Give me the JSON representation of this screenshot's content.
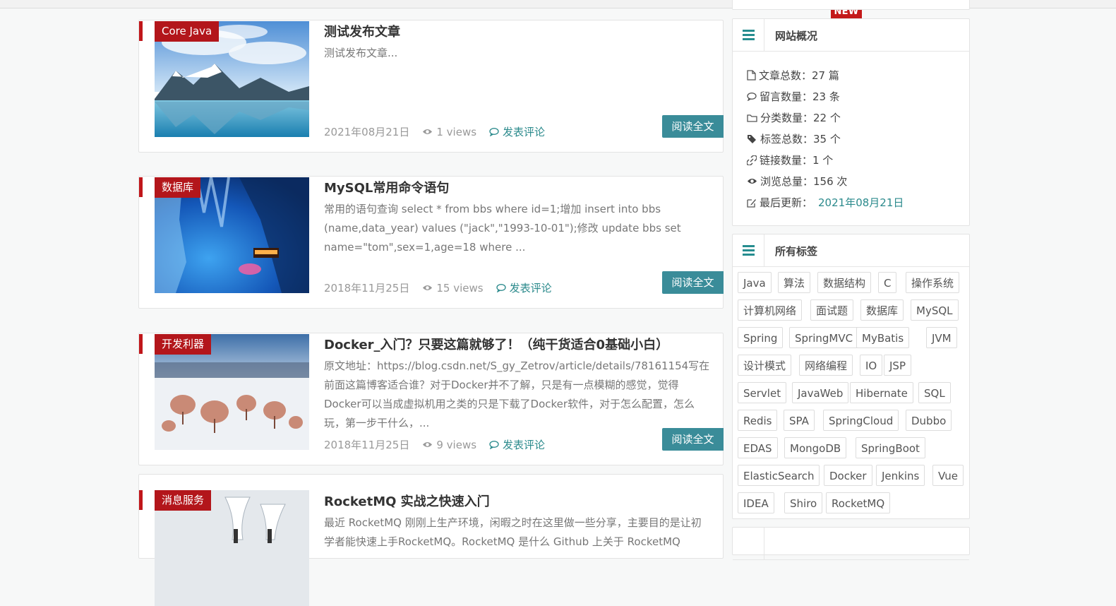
{
  "colors": {
    "accent": "#3a8c99",
    "category": "#b3161b",
    "link": "#2b8a8c",
    "badge": "#c4191a"
  },
  "badge_new": "NEW",
  "posts": [
    {
      "category": "Core Java",
      "title": "测试发布文章",
      "excerpt": "测试发布文章...",
      "date": "2021年08月21日",
      "views": "1 views",
      "comment": "发表评论",
      "read_more": "阅读全文",
      "image": "snow-mountain-lake"
    },
    {
      "category": "数据库",
      "title": "MySQL常用命令语句",
      "excerpt": "常用的语句查询 select * from bbs where id=1;增加 insert into bbs (name,data_year) values (\"jack\",\"1993-10-01\");修改 update bbs set name=\"tom\",sex=1,age=18 where ...",
      "date": "2018年11月25日",
      "views": "15 views",
      "comment": "发表评论",
      "read_more": "阅读全文",
      "image": "ice-cave"
    },
    {
      "category": "开发利器",
      "title": "Docker_入门？只要这篇就够了！（纯干货适合0基础小白）",
      "excerpt": "原文地址：https://blog.csdn.net/S_gy_Zetrov/article/details/78161154写在前面这篇博客适合谁？对于Docker并不了解，只是有一点模糊的感觉，觉得Docker可以当成虚拟机用之类的只是下载了Docker软件，对于怎么配置，怎么玩，第一步干什么，...",
      "date": "2018年11月25日",
      "views": "9 views",
      "comment": "发表评论",
      "read_more": "阅读全文",
      "image": "snowy-trees"
    },
    {
      "category": "消息服务",
      "title": "RocketMQ 实战之快速入门",
      "excerpt": "最近 RocketMQ 刚刚上生产环境，闲暇之时在这里做一些分享，主要目的是让初学者能快速上手RocketMQ。RocketMQ 是什么 Github 上关于 RocketMQ",
      "date": "",
      "views": "",
      "comment": "",
      "read_more": "",
      "image": "cranes-snow"
    }
  ],
  "site_overview": {
    "title": "网站概况",
    "stats": [
      {
        "icon": "file-icon",
        "label": "文章总数：27 篇"
      },
      {
        "icon": "comment-icon",
        "label": "留言数量：23 条"
      },
      {
        "icon": "folder-icon",
        "label": "分类数量：22 个"
      },
      {
        "icon": "tags-icon",
        "label": "标签总数：35 个"
      },
      {
        "icon": "link-icon",
        "label": "链接数量：1 个"
      },
      {
        "icon": "eye-icon",
        "label": "浏览总量：156 次"
      },
      {
        "icon": "edit-icon",
        "label": "最后更新：",
        "value": "2021年08月21日"
      }
    ]
  },
  "all_tags": {
    "title": "所有标签",
    "tags": [
      "Java",
      "算法",
      "数据结构",
      "C",
      "操作系统",
      "计算机网络",
      "面试题",
      "数据库",
      "MySQL",
      "Spring",
      "SpringMVC",
      "MyBatis",
      "JVM",
      "设计模式",
      "网络编程",
      "IO",
      "JSP",
      "Servlet",
      "JavaWeb",
      "Hibernate",
      "SQL",
      "Redis",
      "SPA",
      "SpringCloud",
      "Dubbo",
      "EDAS",
      "MongoDB",
      "SpringBoot",
      "ElasticSearch",
      "Docker",
      "Jenkins",
      "Vue",
      "IDEA",
      "Shiro",
      "RocketMQ"
    ]
  }
}
